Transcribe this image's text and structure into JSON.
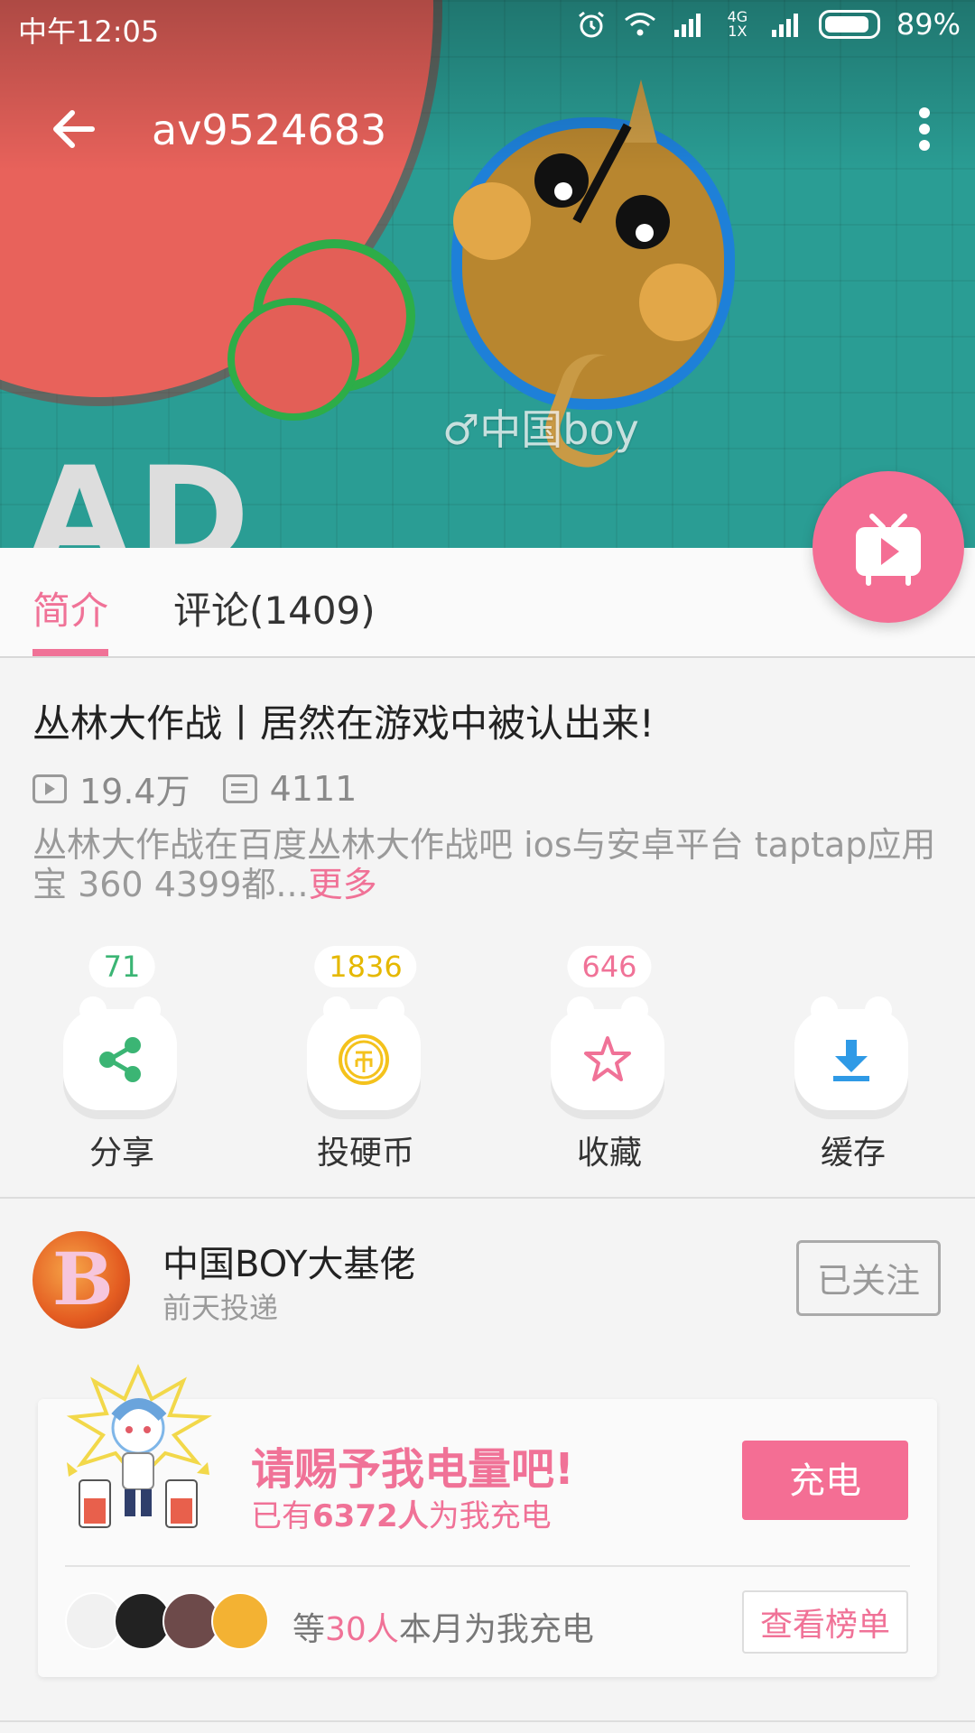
{
  "status_bar": {
    "time": "中午12:05",
    "network": "4G 1X",
    "battery": "89%"
  },
  "header": {
    "title": "av9524683"
  },
  "cover": {
    "watermark": "♂中国boy",
    "overlay_text": "AD"
  },
  "tabs": [
    {
      "label": "简介",
      "active": true
    },
    {
      "label": "评论(1409)",
      "active": false
    }
  ],
  "video": {
    "title": "丛林大作战丨居然在游戏中被认出来!",
    "views": "19.4万",
    "danmaku": "4111",
    "description": "丛林大作战在百度丛林大作战吧 ios与安卓平台 taptap应用宝 360 4399都...",
    "more_label": "更多"
  },
  "actions": [
    {
      "label": "分享",
      "count": "71",
      "icon": "share-icon",
      "color": "#3bb574"
    },
    {
      "label": "投硬币",
      "count": "1836",
      "icon": "coin-icon",
      "color": "#f4c21c"
    },
    {
      "label": "收藏",
      "count": "646",
      "icon": "star-icon",
      "color": "#f07297"
    },
    {
      "label": "缓存",
      "count": "",
      "icon": "download-icon",
      "color": "#2f9ae6"
    }
  ],
  "uploader": {
    "name": "中国BOY大基佬",
    "upload_time": "前天投递",
    "follow_label": "已关注"
  },
  "charge": {
    "title": "请赐予我电量吧!",
    "sub_prefix": "已有",
    "sub_count": "6372人",
    "sub_suffix": "为我充电",
    "button_label": "充电",
    "supporters_prefix": "等",
    "supporters_count": "30人",
    "supporters_suffix": "本月为我充电",
    "rank_label": "查看榜单"
  },
  "colors": {
    "accent": "#f07297",
    "fab": "#f46e94"
  }
}
